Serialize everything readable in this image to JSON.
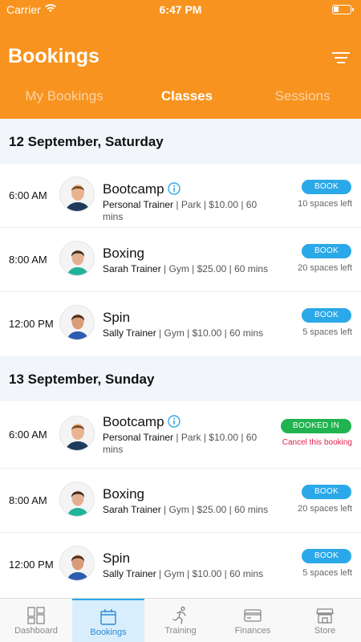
{
  "status": {
    "carrier": "Carrier",
    "time": "6:47 PM"
  },
  "header": {
    "title": "Bookings"
  },
  "tabs": [
    {
      "label": "My Bookings"
    },
    {
      "label": "Classes"
    },
    {
      "label": "Sessions"
    }
  ],
  "days": [
    {
      "date": "12 September, Saturday",
      "classes": [
        {
          "time": "6:00 AM",
          "name": "Bootcamp",
          "trainer": "Personal Trainer",
          "rest": " | Park | $10.00 | 60 mins",
          "button": "BOOK",
          "note": "10 spaces left"
        },
        {
          "time": "8:00 AM",
          "name": "Boxing",
          "trainer": "Sarah Trainer",
          "rest": " | Gym | $25.00 | 60 mins",
          "button": "BOOK",
          "note": "20 spaces left"
        },
        {
          "time": "12:00 PM",
          "name": "Spin",
          "trainer": "Sally Trainer",
          "rest": " | Gym | $10.00 | 60 mins",
          "button": "BOOK",
          "note": "5 spaces left"
        }
      ]
    },
    {
      "date": "13 September, Sunday",
      "classes": [
        {
          "time": "6:00 AM",
          "name": "Bootcamp",
          "trainer": "Personal Trainer",
          "rest": " | Park | $10.00 | 60 mins",
          "button": "BOOKED IN",
          "note": "Cancel this booking"
        },
        {
          "time": "8:00 AM",
          "name": "Boxing",
          "trainer": "Sarah Trainer",
          "rest": " | Gym | $25.00 | 60 mins",
          "button": "BOOK",
          "note": "20 spaces left"
        },
        {
          "time": "12:00 PM",
          "name": "Spin",
          "trainer": "Sally Trainer",
          "rest": " | Gym | $10.00 | 60 mins",
          "button": "BOOK",
          "note": "5 spaces left"
        }
      ]
    }
  ],
  "tabbar": [
    {
      "label": "Dashboard"
    },
    {
      "label": "Bookings"
    },
    {
      "label": "Training"
    },
    {
      "label": "Finances"
    },
    {
      "label": "Store"
    }
  ],
  "colors": {
    "brand": "#f7931e",
    "book": "#2ba8e8",
    "booked": "#20b34f",
    "cancel": "#e01f4e"
  }
}
